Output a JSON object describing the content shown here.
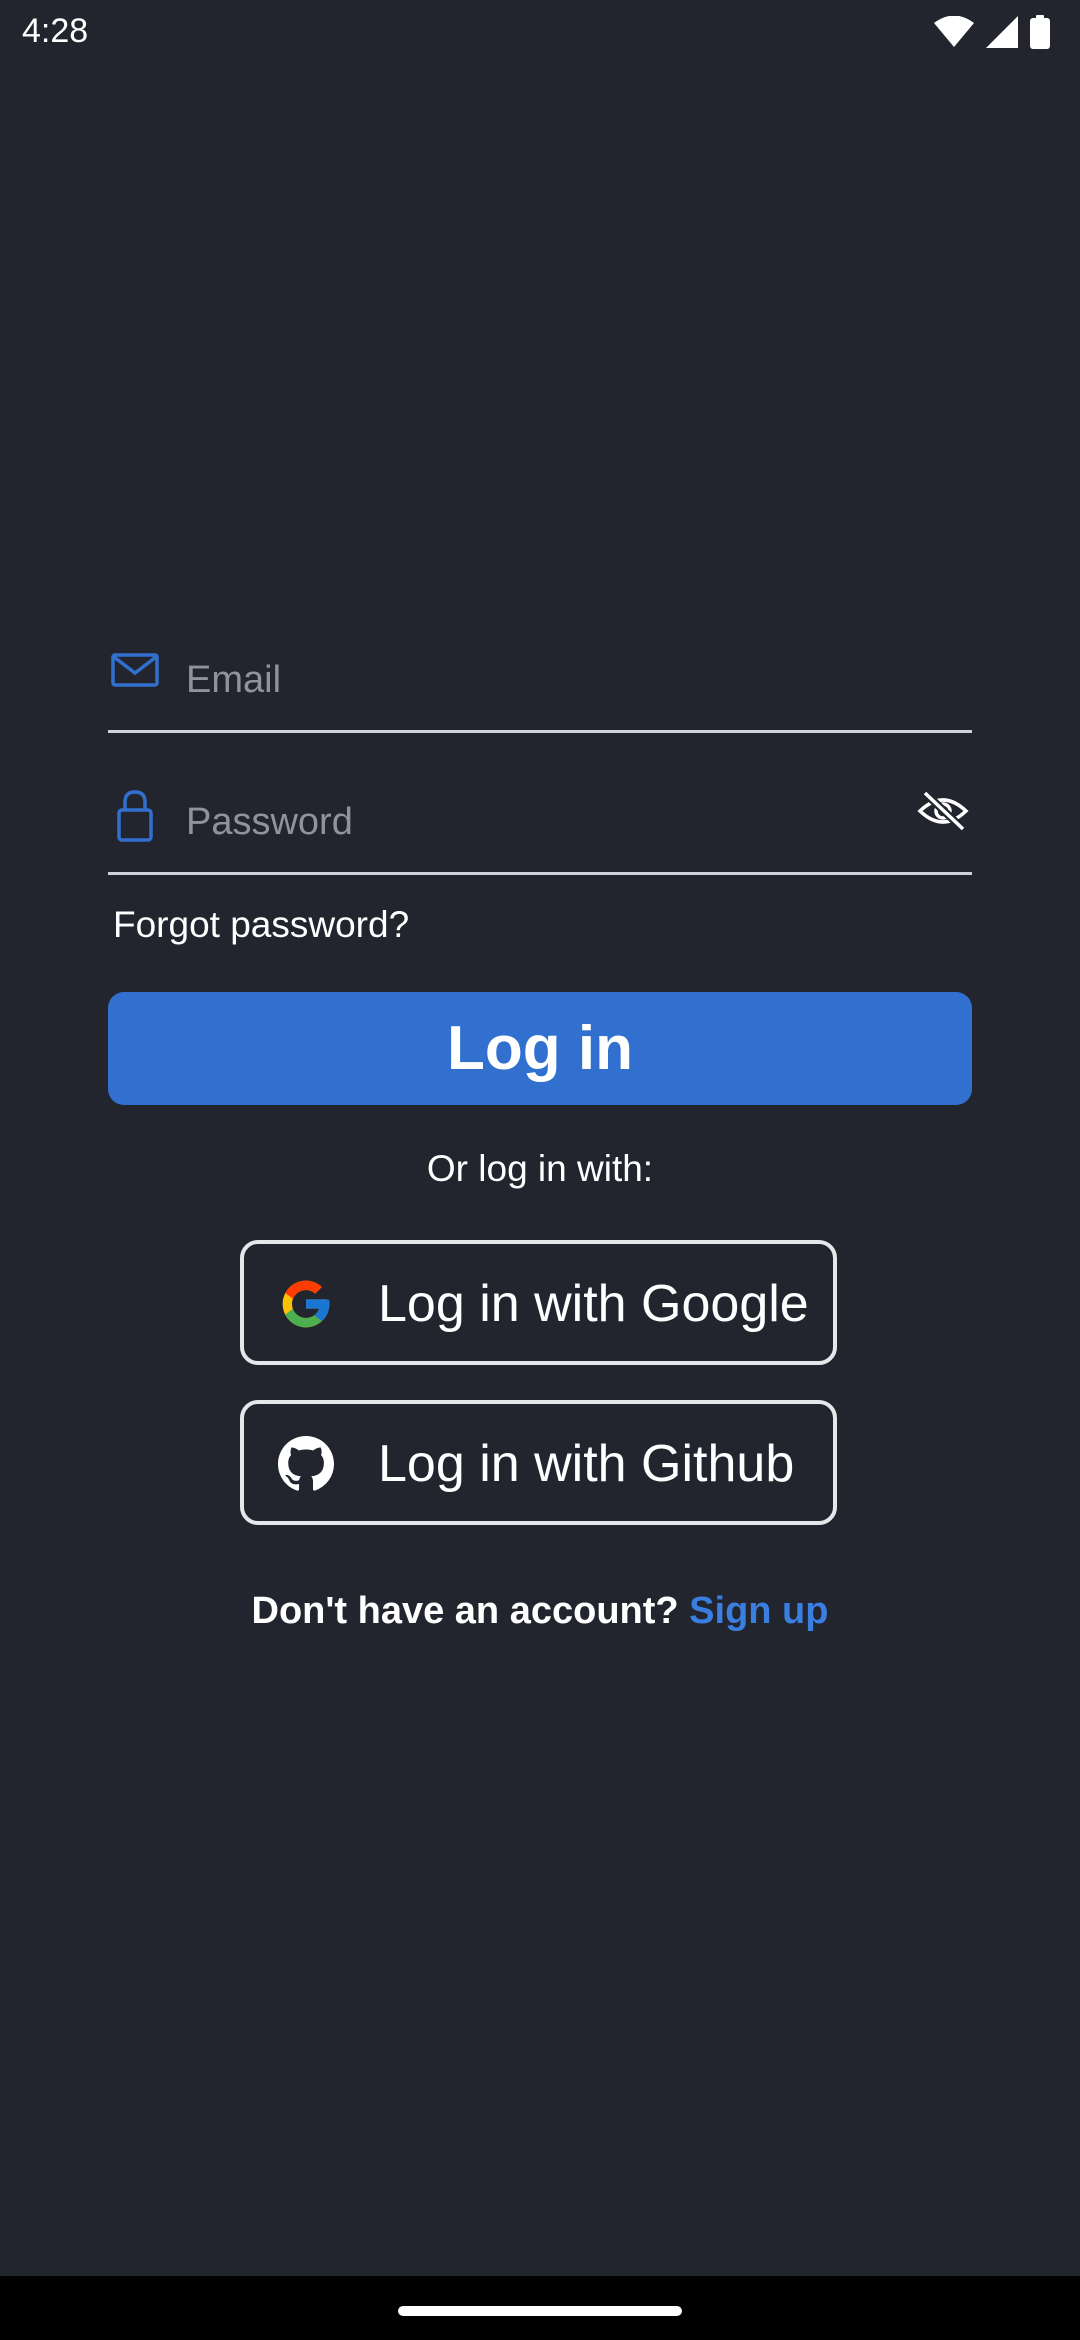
{
  "status_bar": {
    "time": "4:28",
    "icons": [
      "wifi-icon",
      "signal-icon",
      "battery-icon"
    ]
  },
  "form": {
    "email": {
      "placeholder": "Email",
      "value": "",
      "icon": "mail-icon"
    },
    "password": {
      "placeholder": "Password",
      "value": "",
      "icon": "lock-icon",
      "toggle_icon": "eye-off-icon"
    },
    "forgot_label": "Forgot password?",
    "login_label": "Log in"
  },
  "social": {
    "heading": "Or log in with:",
    "google_label": "Log in with Google",
    "github_label": "Log in with Github"
  },
  "signup": {
    "prompt": "Don't have an account?",
    "link": "Sign up"
  },
  "colors": {
    "background": "#22252e",
    "accent": "#3170cf",
    "link": "#3a7ee0",
    "field_line": "#cfd2d8",
    "placeholder": "#8f939b"
  }
}
